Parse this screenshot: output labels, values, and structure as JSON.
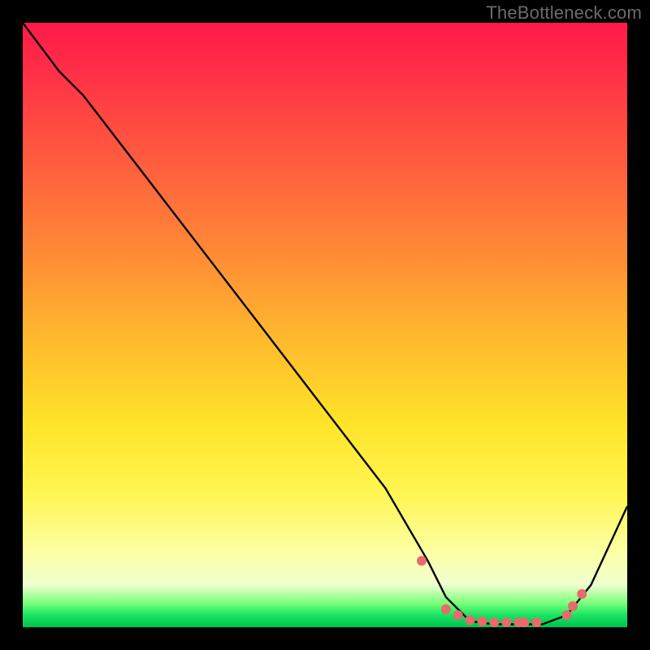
{
  "attribution": "TheBottleneck.com",
  "chart_data": {
    "type": "line",
    "title": "",
    "xlabel": "",
    "ylabel": "",
    "xlim": [
      0,
      100
    ],
    "ylim": [
      0,
      100
    ],
    "series": [
      {
        "name": "curve",
        "x": [
          0,
          6,
          10,
          20,
          30,
          40,
          50,
          60,
          67,
          70,
          74,
          78,
          82,
          86,
          90,
          94,
          100
        ],
        "y": [
          100,
          92,
          88,
          75,
          62,
          49,
          36,
          23,
          11,
          5,
          1,
          0.5,
          0.5,
          0.5,
          2,
          7,
          20
        ]
      }
    ],
    "markers": {
      "name": "dots",
      "x": [
        66,
        70,
        72,
        74,
        76,
        78,
        80,
        82,
        83,
        85,
        90,
        91,
        92.5
      ],
      "y": [
        11,
        3,
        2,
        1.2,
        1,
        0.8,
        0.8,
        0.8,
        0.8,
        0.8,
        2,
        3.5,
        5.5
      ]
    },
    "colors": {
      "line": "#000000",
      "marker": "#e96a6a",
      "gradient_top": "#ff1a4a",
      "gradient_mid": "#ffe328",
      "gradient_bottom": "#00c24e"
    }
  }
}
